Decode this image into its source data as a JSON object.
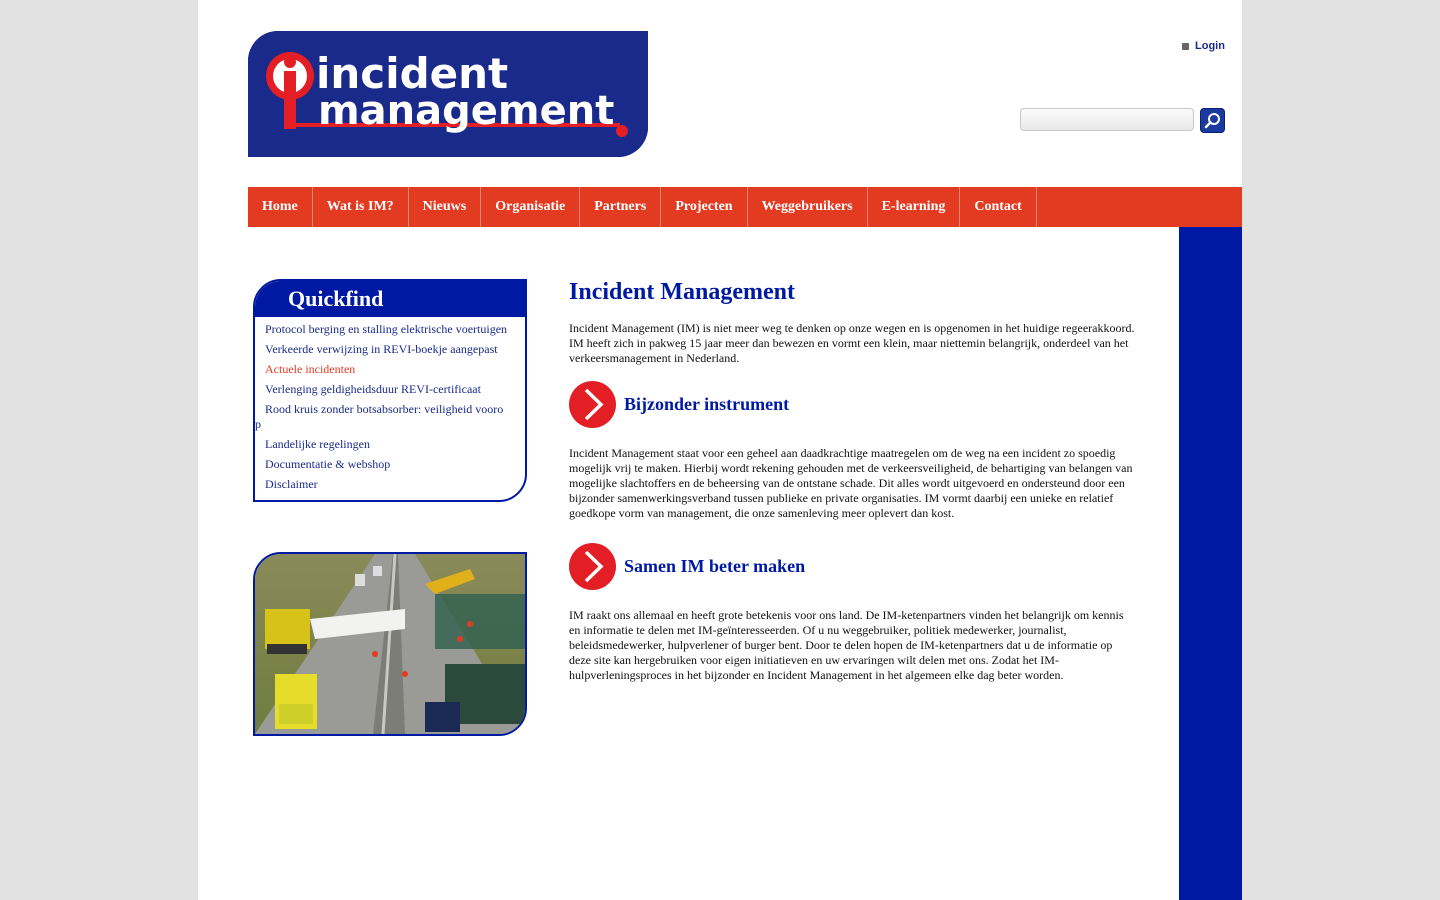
{
  "header": {
    "logo_line1": "incident",
    "logo_line2": "management",
    "login_label": "Login",
    "search_placeholder": ""
  },
  "nav": {
    "items": [
      {
        "label": "Home"
      },
      {
        "label": "Wat is IM?"
      },
      {
        "label": "Nieuws"
      },
      {
        "label": "Organisatie"
      },
      {
        "label": "Partners"
      },
      {
        "label": "Projecten"
      },
      {
        "label": "Weggebruikers"
      },
      {
        "label": "E-learning"
      },
      {
        "label": "Contact"
      }
    ]
  },
  "quickfind": {
    "title": "Quickfind",
    "items": [
      {
        "label": "Protocol berging en stalling elektrische voertuigen"
      },
      {
        "label": "Verkeerde verwijzing in REVI-boekje aangepast"
      },
      {
        "label": "Actuele incidenten"
      },
      {
        "label": "Verlenging geldigheidsduur REVI-certificaat"
      },
      {
        "label": "Rood kruis zonder botsabsorber: veiligheid vooro",
        "cont": "p"
      },
      {
        "label": "Landelijke regelingen"
      },
      {
        "label": "Documentatie & webshop"
      },
      {
        "label": "Disclaimer"
      }
    ]
  },
  "main": {
    "title": "Incident Management",
    "intro": "Incident Management (IM) is niet meer weg te denken op onze wegen en is opgenomen in het huidige regeerakkoord. IM heeft zich in pakweg 15 jaar meer dan bewezen en vormt een klein, maar niettemin belangrijk, onderdeel van het verkeersmanagement in Nederland.",
    "sections": [
      {
        "heading": "Bijzonder instrument",
        "text": "Incident Management staat voor een geheel aan daadkrachtige maatregelen om de weg na een incident zo spoedig mogelijk vrij te maken. Hierbij wordt rekening gehouden met de verkeersveiligheid, de behartiging van belangen van mogelijke slachtoffers en de beheersing van de ontstane schade. Dit alles wordt uitgevoerd en ondersteund door een bijzonder samenwerkingsverband tussen publieke en private organisaties. IM vormt daarbij een unieke en relatief goedkope vorm van management, die onze samenleving meer oplevert dan kost."
      },
      {
        "heading": "Samen IM beter maken",
        "text": "IM raakt ons allemaal en heeft grote betekenis voor ons land. De IM-ketenpartners vinden het belangrijk om kennis en informatie te delen met IM-geïnteresseerden. Of u nu weggebruiker, politiek medewerker, journalist, beleidsmedewerker, hulpverlener of burger bent. Door te delen hopen de IM-ketenpartners dat u de informatie op deze site kan hergebruiken voor eigen initiatieven en uw ervaringen wilt delen met ons. Zodat het IM-hulpverleningsproces in het bijzonder en Incident Management in het algemeen elke dag beter worden."
      }
    ]
  },
  "colors": {
    "brand_blue": "#0019a3",
    "brand_red": "#e33a22",
    "background": "#e2e2e2"
  },
  "icons": [
    "bullet-icon",
    "search-icon",
    "arrow-right-icon"
  ]
}
